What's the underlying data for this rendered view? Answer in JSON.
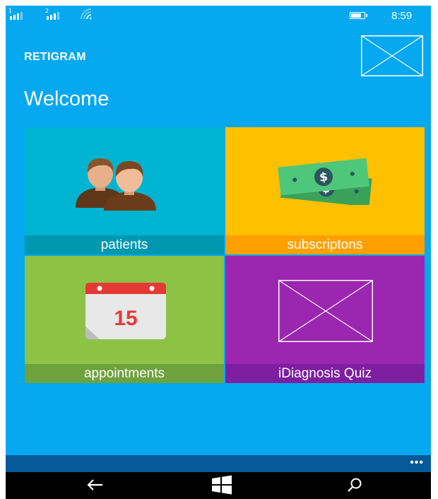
{
  "status_bar": {
    "sim1": "1",
    "sim2": "2",
    "time": "8:59",
    "icons": [
      "signal-sim1-icon",
      "signal-sim2-icon",
      "wifi-icon",
      "battery-icon"
    ]
  },
  "header": {
    "app_title": "RETIGRAM",
    "profile_image": "image-placeholder-icon"
  },
  "welcome": "Welcome",
  "tiles": [
    {
      "label": "patients",
      "icon": "patients-icon",
      "color": "#00b4d1",
      "band_color": "#0098b0"
    },
    {
      "label": "subscriptons",
      "icon": "money-icon",
      "color": "#ffc000",
      "band_color": "#ffa000"
    },
    {
      "label": "appointments",
      "icon": "calendar-icon",
      "color": "#8cc246",
      "band_color": "#6ea23c"
    },
    {
      "label": "iDiagnosis Quiz",
      "icon": "image-placeholder-icon",
      "color": "#9b26af",
      "band_color": "#7d1fa0"
    }
  ],
  "calendar_day": "15",
  "app_bar": {
    "more": "•••"
  },
  "nav_bar": {
    "icons": [
      "back-icon",
      "windows-start-icon",
      "search-icon"
    ]
  },
  "colors": {
    "background": "#06a8f0",
    "app_bar": "#075a9a",
    "nav_bar": "#000000"
  }
}
